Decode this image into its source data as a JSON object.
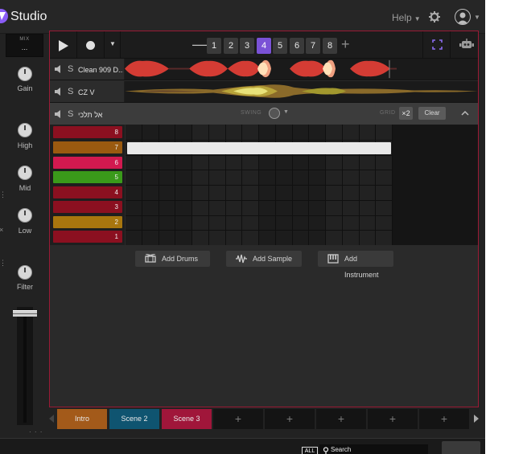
{
  "app": {
    "title": "Studio"
  },
  "header": {
    "help_label": "Help"
  },
  "mixer": {
    "label": "MIX",
    "value": "...",
    "knobs": [
      {
        "label": "Gain"
      },
      {
        "label": "High"
      },
      {
        "label": "Mid"
      },
      {
        "label": "Low"
      },
      {
        "label": "Filter"
      }
    ],
    "more": "· · ·"
  },
  "transport": {
    "patterns": [
      "1",
      "2",
      "3",
      "4",
      "5",
      "6",
      "7",
      "8"
    ],
    "active_pattern": "4"
  },
  "tracks": [
    {
      "name": "Clean 909 D...",
      "solo": "S"
    },
    {
      "name": "CZ V",
      "solo": "S"
    },
    {
      "name": "אל תלכי",
      "solo": "S"
    }
  ],
  "sequencer": {
    "swing_label": "SWING",
    "grid_label": "GRID",
    "grid_value": "×2",
    "clear_label": "Clear",
    "pads": [
      {
        "label": "8",
        "color": "#8b1020"
      },
      {
        "label": "7",
        "color": "#9a5a10"
      },
      {
        "label": "6",
        "color": "#d2194f"
      },
      {
        "label": "5",
        "color": "#3a9a1a"
      },
      {
        "label": "4",
        "color": "#8b1020"
      },
      {
        "label": "3",
        "color": "#8b1020"
      },
      {
        "label": "2",
        "color": "#a8760e"
      },
      {
        "label": "1",
        "color": "#8b1020"
      }
    ],
    "active_row": "7"
  },
  "add_buttons": {
    "drums": "Add Drums",
    "sample": "Add Sample",
    "instrument": "Add Instrument"
  },
  "scenes": [
    {
      "label": "Intro",
      "color": "#a35a1a"
    },
    {
      "label": "Scene 2",
      "color": "#0f5470"
    },
    {
      "label": "Scene 3",
      "color": "#a0163a"
    },
    {
      "label": "+"
    },
    {
      "label": "+"
    },
    {
      "label": "+"
    },
    {
      "label": "+"
    },
    {
      "label": "+"
    }
  ],
  "library": {
    "filter_label": "ALL",
    "search_placeholder": "Search"
  }
}
